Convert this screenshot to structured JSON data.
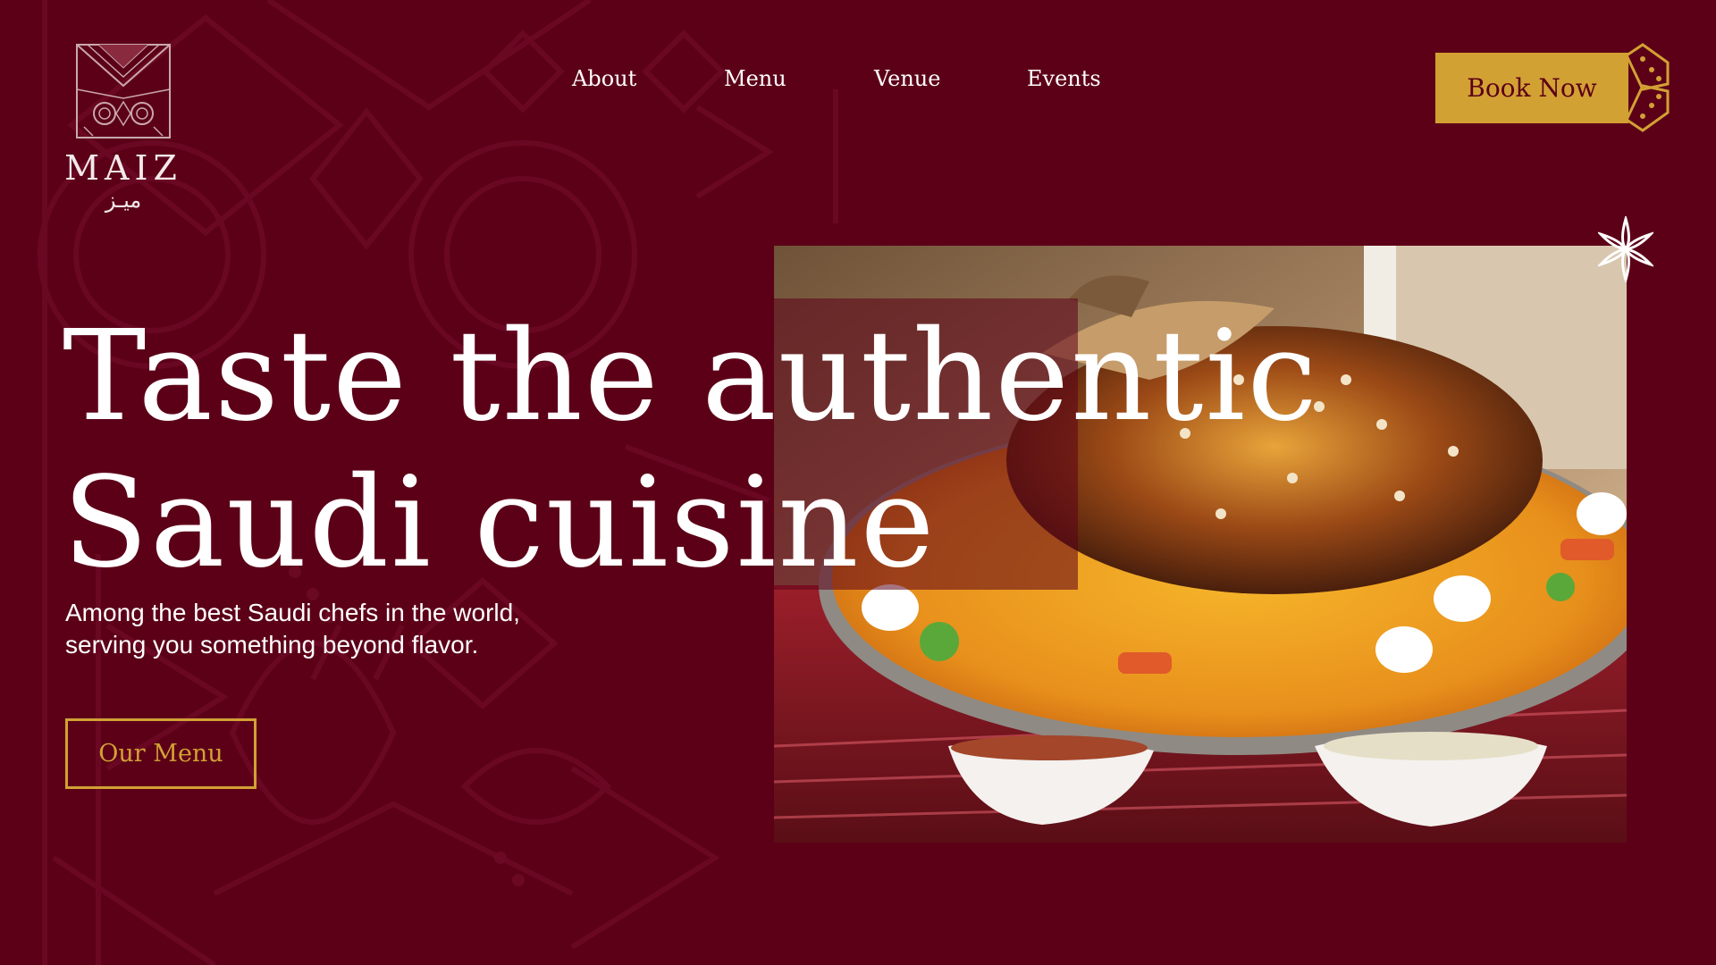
{
  "colors": {
    "background": "#5c0018",
    "accent_gold": "#d2a133",
    "text": "#ffffff"
  },
  "brand": {
    "name": "MAIZ",
    "arabic_name": "ميـز",
    "emblem_icon": "geometric-sadu-emblem-icon"
  },
  "nav": {
    "items": [
      {
        "label": "About"
      },
      {
        "label": "Menu"
      },
      {
        "label": "Venue"
      },
      {
        "label": "Events"
      }
    ]
  },
  "header": {
    "book_label": "Book Now",
    "book_ornament_icon": "diamond-ornament-icon"
  },
  "hero": {
    "title_line1": "Taste the authentic",
    "title_line2": "Saudi cuisine",
    "subtitle_line1": "Among the best Saudi chefs in the world,",
    "subtitle_line2": "serving you something beyond flavor.",
    "cta_label": "Our Menu",
    "star_icon": "eight-point-star-icon",
    "photo_subject": "kabsa-platter-image"
  }
}
